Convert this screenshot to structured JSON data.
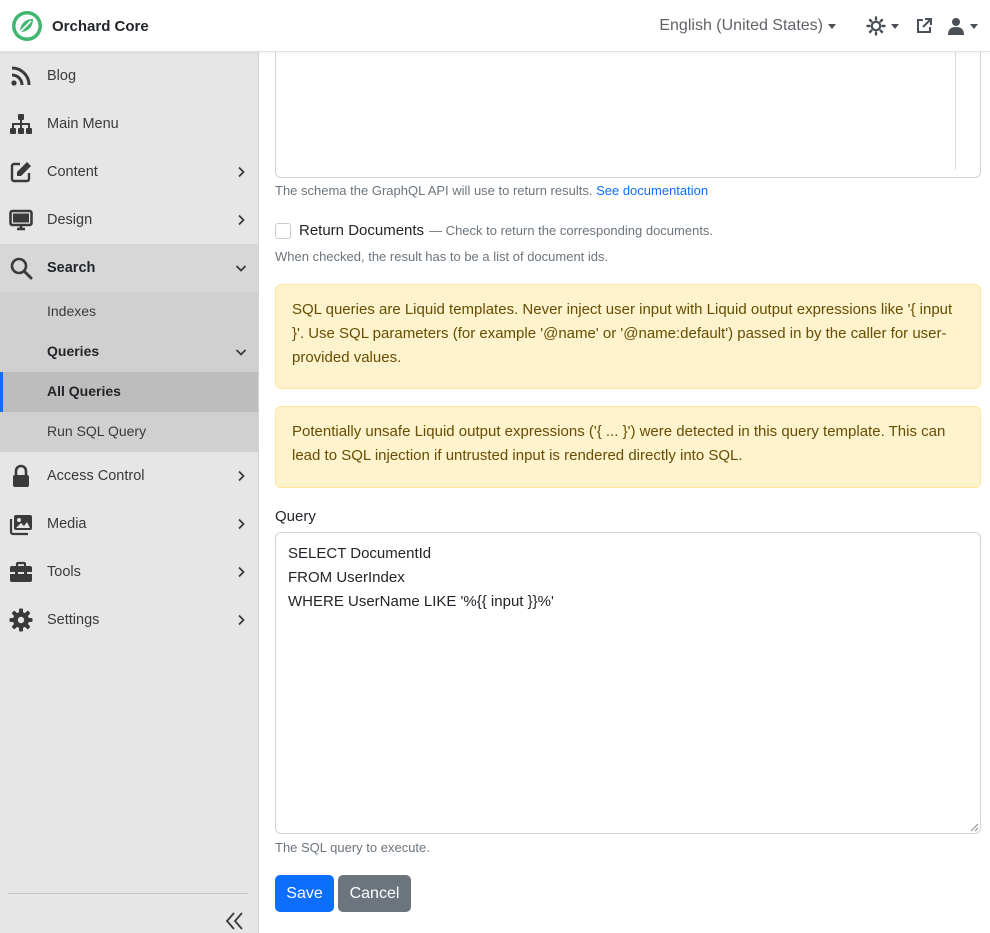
{
  "brand": {
    "name": "Orchard Core"
  },
  "navbar": {
    "language": "English (United States)",
    "theme_icon": "sun-icon",
    "external_icon": "external-link-icon",
    "user_icon": "user-icon"
  },
  "sidebar": {
    "items": [
      {
        "label": "Blog",
        "icon": "rss-icon"
      },
      {
        "label": "Main Menu",
        "icon": "sitemap-icon"
      },
      {
        "label": "Content",
        "icon": "edit-icon"
      },
      {
        "label": "Design",
        "icon": "monitor-icon"
      },
      {
        "label": "Search",
        "icon": "search-icon"
      },
      {
        "label": "Access Control",
        "icon": "lock-icon"
      },
      {
        "label": "Media",
        "icon": "images-icon"
      },
      {
        "label": "Tools",
        "icon": "toolbox-icon"
      },
      {
        "label": "Settings",
        "icon": "gear-icon"
      }
    ],
    "search_children": {
      "indexes": "Indexes",
      "queries": "Queries",
      "all_queries": "All Queries",
      "run_sql_query": "Run SQL Query"
    }
  },
  "form": {
    "schema_help_text": "The schema the GraphQL API will use to return results.",
    "schema_help_link": "See documentation",
    "return_documents_label": "Return Documents",
    "return_documents_hint": "— Check to return the corresponding documents.",
    "return_documents_help": "When checked, the result has to be a list of document ids.",
    "alert_1": "SQL queries are Liquid templates. Never inject user input with Liquid output expressions like '{ input }'. Use SQL parameters (for example '@name' or '@name:default') passed in by the caller for user-provided values.",
    "alert_2": "Potentially unsafe Liquid output expressions ('{ ... }') were detected in this query template. This can lead to SQL injection if untrusted input is rendered directly into SQL.",
    "query_label": "Query",
    "query_value": "SELECT DocumentId\nFROM UserIndex\nWHERE UserName LIKE '%{{ input }}%'",
    "query_help": "The SQL query to execute.",
    "save_label": "Save",
    "cancel_label": "Cancel"
  },
  "colors": {
    "primary": "#0d6efd",
    "secondary": "#6c757d",
    "warning_bg": "#fff3cd",
    "warning_text": "#664d03",
    "brand_green": "#41b670",
    "sidebar_bg": "#e6e6e6"
  }
}
